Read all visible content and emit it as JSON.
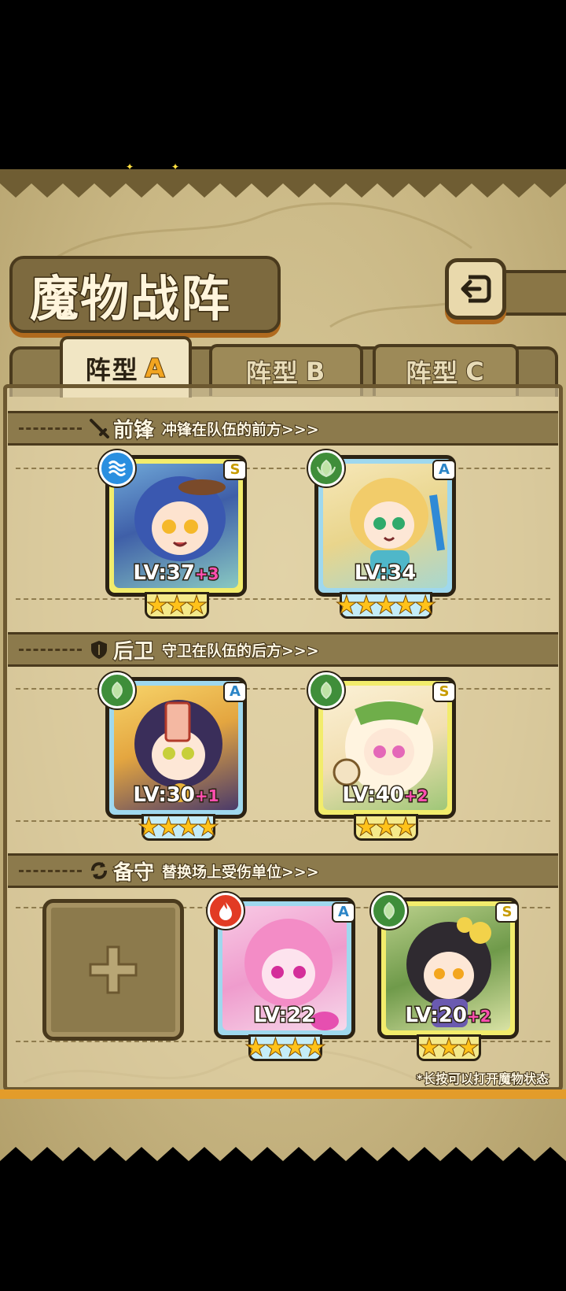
{
  "header": {
    "title": "魔物战阵",
    "back_icon": "return-arrow-icon"
  },
  "tabs": [
    {
      "label": "阵型",
      "letter": "A",
      "active": true
    },
    {
      "label": "阵型",
      "letter": "B",
      "active": false
    },
    {
      "label": "阵型",
      "letter": "C",
      "active": false
    }
  ],
  "sections": {
    "vanguard": {
      "title": "前锋",
      "desc": "冲锋在队伍的前方>>>",
      "icon": "sword-icon"
    },
    "rearguard": {
      "title": "后卫",
      "desc": "守卫在队伍的后方>>>",
      "icon": "shield-icon"
    },
    "reserve": {
      "title": "备守",
      "desc": "替换场上受伤单位>>>",
      "icon": "swap-icon"
    }
  },
  "cards": {
    "v1": {
      "lv": "LV:37",
      "plus": "+3",
      "rank": "S",
      "element": "water",
      "stars": "★★★"
    },
    "v2": {
      "lv": "LV:34",
      "plus": "",
      "rank": "A",
      "element": "nature",
      "stars": "★★★★★"
    },
    "r1": {
      "lv": "LV:30",
      "plus": "+1",
      "rank": "A",
      "element": "nature",
      "stars": "★★★★"
    },
    "r2": {
      "lv": "LV:40",
      "plus": "+2",
      "rank": "S",
      "element": "nature",
      "stars": "★★★"
    },
    "b1": {
      "lv": "LV:22",
      "plus": "",
      "rank": "A",
      "element": "fire",
      "stars": "★★★★"
    },
    "b2": {
      "lv": "LV:20",
      "plus": "+2",
      "rank": "S",
      "element": "nature",
      "stars": "★★★"
    }
  },
  "empty_slot": {
    "icon": "plus-icon"
  },
  "hint": "*长按可以打开魔物状态"
}
